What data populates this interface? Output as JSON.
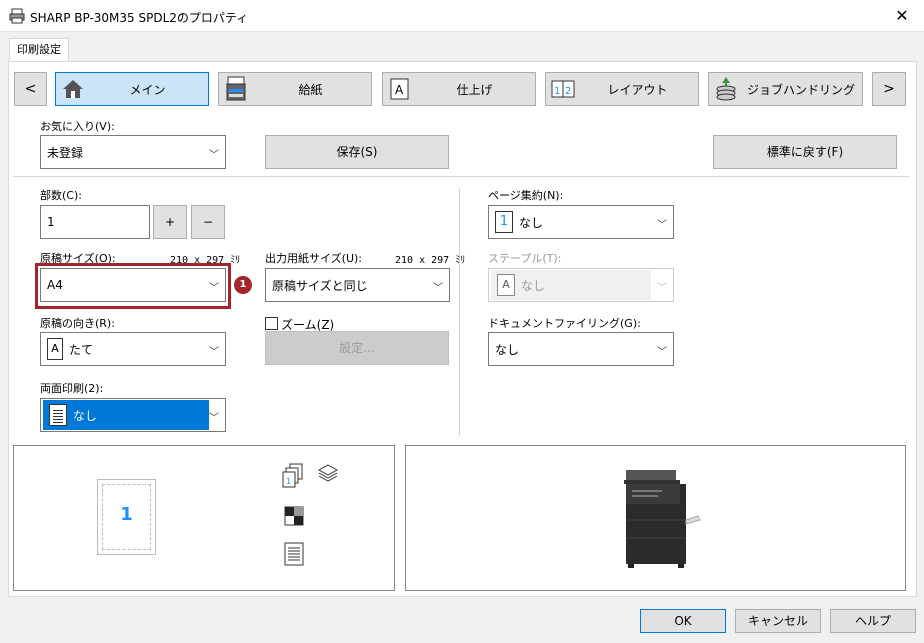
{
  "window": {
    "title": "SHARP BP-30M35 SPDL2のプロパティ",
    "close": "✕"
  },
  "tab": {
    "label": "印刷設定"
  },
  "nav": {
    "prev": "<",
    "next": ">",
    "items": [
      {
        "label": "メイン",
        "icon": "home-icon"
      },
      {
        "label": "給紙",
        "icon": "printer-tray-icon"
      },
      {
        "label": "仕上げ",
        "icon": "finishing-icon"
      },
      {
        "label": "レイアウト",
        "icon": "layout-icon"
      },
      {
        "label": "ジョブハンドリング",
        "icon": "job-handling-icon"
      }
    ]
  },
  "favorites": {
    "label": "お気に入り(V):",
    "value": "未登録"
  },
  "save_button": "保存(S)",
  "reset_button": "標準に戻す(F)",
  "copies": {
    "label": "部数(C):",
    "value": "1",
    "plus": "+",
    "minus": "−"
  },
  "original_size": {
    "label": "原稿サイズ(O):",
    "dims": "210 x 297 ﾐﾘ",
    "value": "A4",
    "badge": "1"
  },
  "output_size": {
    "label": "出力用紙サイズ(U):",
    "dims": "210 x 297 ﾐﾘ",
    "value": "原稿サイズと同じ"
  },
  "orientation": {
    "label": "原稿の向き(R):",
    "value": "たて",
    "icon_text": "A"
  },
  "zoom": {
    "label": "ズーム(Z)",
    "settings_button": "設定..."
  },
  "duplex": {
    "label": "両面印刷(2):",
    "value": "なし"
  },
  "pages_per_sheet": {
    "label": "ページ集約(N):",
    "value": "なし",
    "icon_text": "1"
  },
  "staple": {
    "label": "ステープル(T):",
    "value": "なし",
    "icon_text": "A"
  },
  "document_filing": {
    "label": "ドキュメントファイリング(G):",
    "value": "なし"
  },
  "preview": {
    "page_number": "1"
  },
  "footer": {
    "ok": "OK",
    "cancel": "キャンセル",
    "help": "ヘルプ"
  },
  "colors": {
    "accent": "#0078d7",
    "highlight_border": "#a4262c",
    "badge": "#a4262c",
    "page_number": "#1e90ff"
  }
}
